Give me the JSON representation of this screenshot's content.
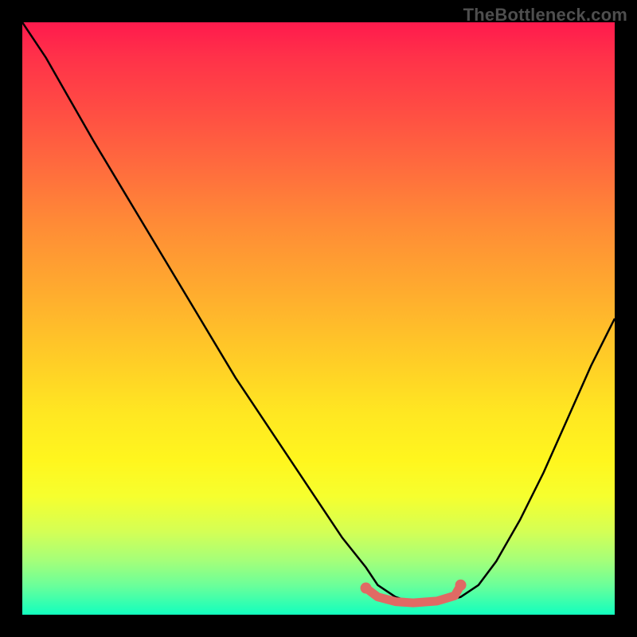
{
  "branding": "TheBottleneck.com",
  "colors": {
    "curve": "#000000",
    "marker": "#e06a64",
    "page_bg": "#000000"
  },
  "chart_data": {
    "type": "line",
    "title": "",
    "xlabel": "",
    "ylabel": "",
    "xlim": [
      0,
      100
    ],
    "ylim": [
      0,
      100
    ],
    "grid": false,
    "series": [
      {
        "name": "curve",
        "x": [
          0,
          4,
          8,
          12,
          18,
          24,
          30,
          36,
          42,
          48,
          54,
          58,
          60,
          63,
          66,
          70,
          74,
          77,
          80,
          84,
          88,
          92,
          96,
          100
        ],
        "y": [
          100,
          94,
          87,
          80,
          70,
          60,
          50,
          40,
          31,
          22,
          13,
          8,
          5,
          3,
          2,
          2,
          3,
          5,
          9,
          16,
          24,
          33,
          42,
          50
        ]
      }
    ],
    "marker_band": {
      "name": "optimal-range",
      "x": [
        58,
        60,
        63,
        66,
        70,
        73,
        74
      ],
      "y": [
        4.5,
        3.0,
        2.2,
        2.0,
        2.3,
        3.2,
        5.0
      ]
    }
  }
}
